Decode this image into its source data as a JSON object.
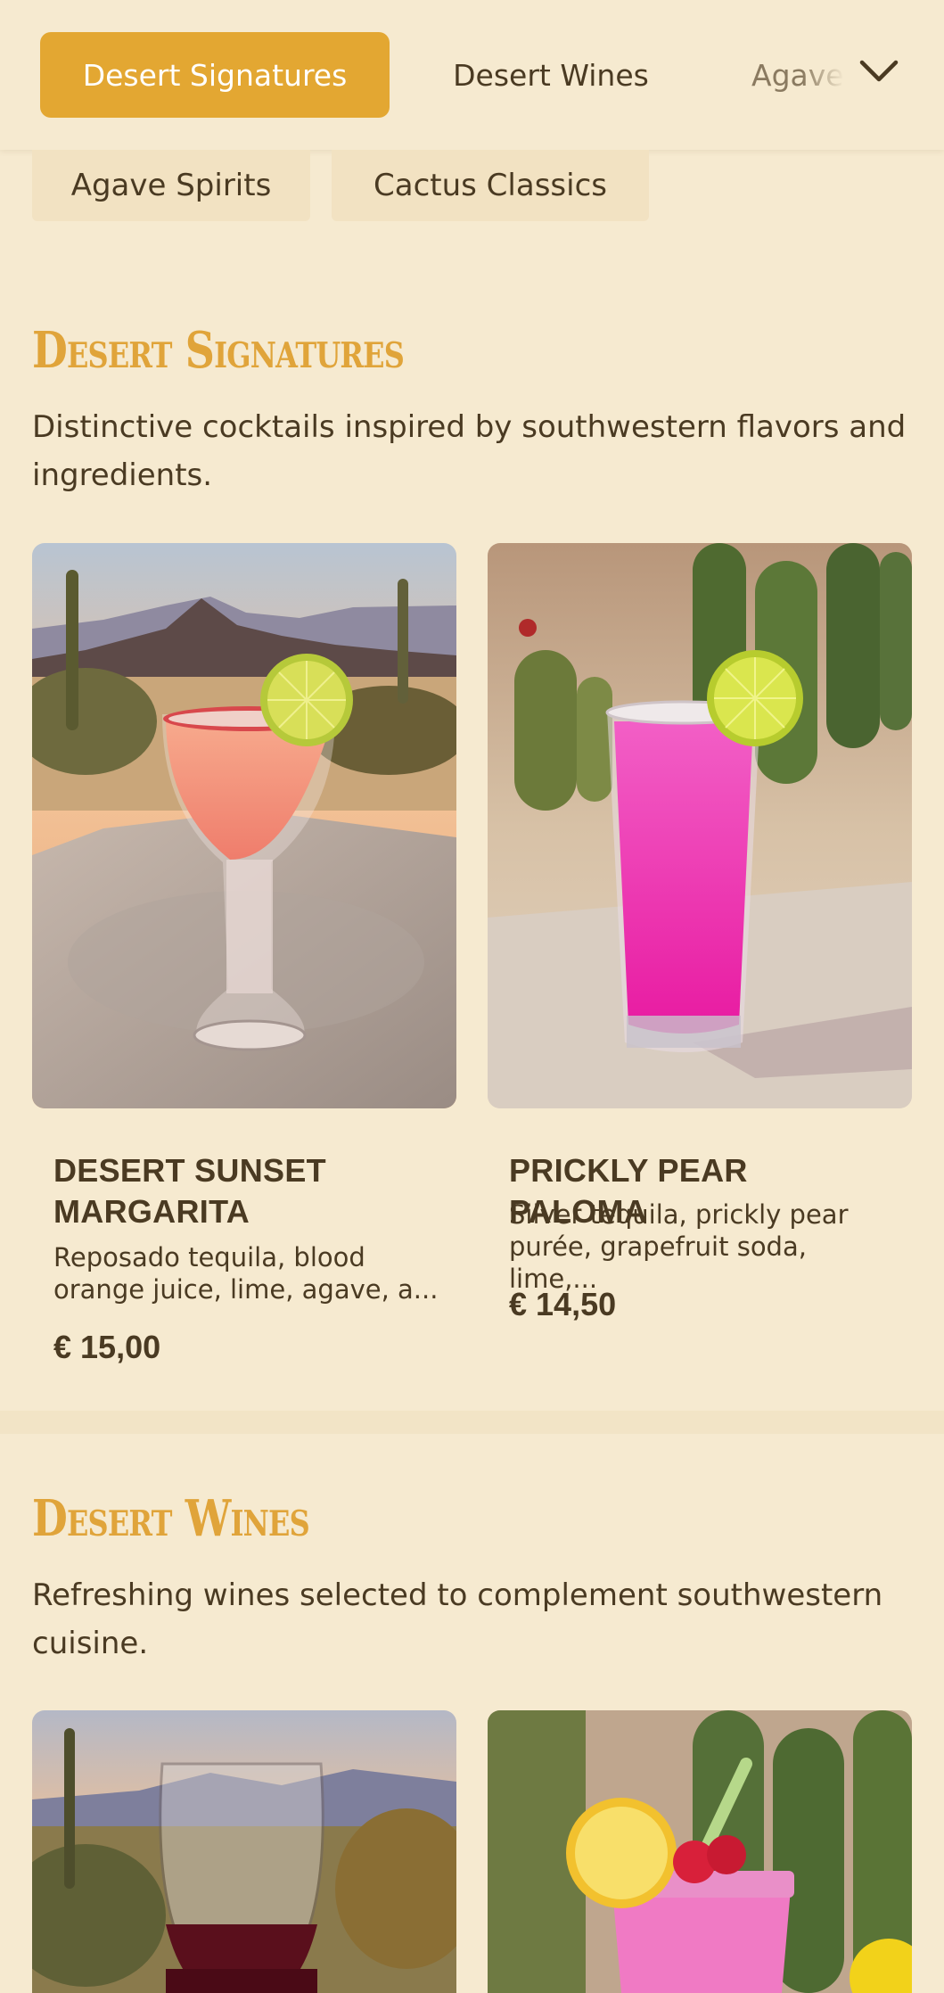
{
  "nav": {
    "tabs": [
      {
        "label": "Desert Signatures",
        "active": true
      },
      {
        "label": "Desert Wines",
        "active": false
      },
      {
        "label": "Agave",
        "active": false
      }
    ],
    "more_icon": "chevron-down-icon",
    "pills": [
      {
        "label": "Agave Spirits"
      },
      {
        "label": "Cactus Classics"
      }
    ],
    "accent_color": "#e3a732"
  },
  "sections": [
    {
      "title": "Desert Signatures",
      "description": "Distinctive cocktails inspired by southwestern flavors and ingredients.",
      "items": [
        {
          "name": "DESERT SUNSET MARGARITA",
          "description": "Reposado tequila, blood orange juice, lime, agave, a...",
          "price": "€ 15,00",
          "image": "margarita-glass-desert-sunset"
        },
        {
          "name": "PRICKLY PEAR PALOMA",
          "description": "Silver tequila, prickly pear purée, grapefruit soda, lime,...",
          "price": "€ 14,50",
          "image": "pink-paloma-highball-cactus"
        }
      ]
    },
    {
      "title": "Desert Wines",
      "description": "Refreshing wines selected to complement southwestern cuisine.",
      "items": [
        {
          "image": "red-wine-glass-desert-sunset"
        },
        {
          "image": "pink-mason-jar-drink-cactus"
        }
      ]
    }
  ],
  "colors": {
    "background": "#f6ead0",
    "heading": "#e0a43a",
    "text": "#4a3a22"
  }
}
